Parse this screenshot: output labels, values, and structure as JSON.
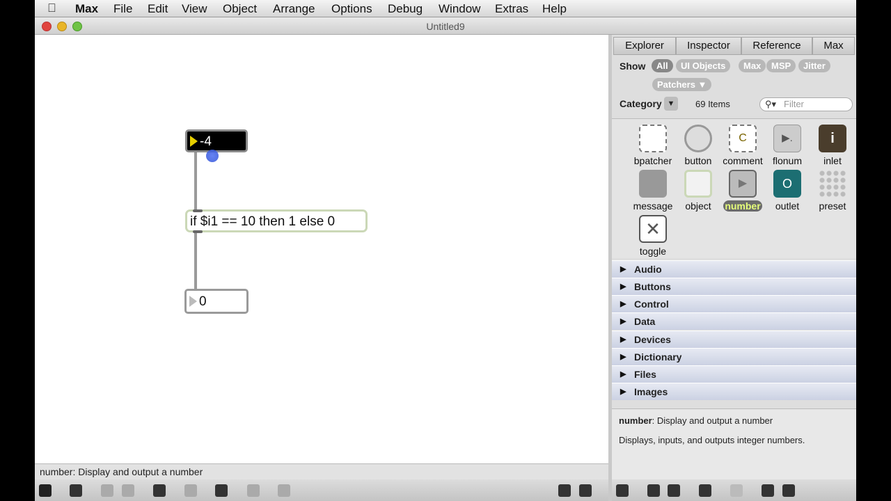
{
  "menubar": {
    "apple_icon": "apple-logo",
    "items": [
      "Max",
      "File",
      "Edit",
      "View",
      "Object",
      "Arrange",
      "Options",
      "Debug",
      "Window",
      "Extras",
      "Help"
    ]
  },
  "window": {
    "title": "Untitled9"
  },
  "patcher": {
    "number_top": "-4",
    "expr_text": "if $i1 == 10 then 1 else 0",
    "number_bottom": "0"
  },
  "status_text": "number: Display and output a number",
  "sidebar": {
    "tabs": [
      "Explorer",
      "Inspector",
      "Reference",
      "Max"
    ],
    "show_label": "Show",
    "filters": [
      "All",
      "UI Objects",
      "Max",
      "MSP",
      "Jitter"
    ],
    "active_filter": "All",
    "patchers_filter": "Patchers ▼",
    "category_label": "Category",
    "category_dropdown": "▼",
    "item_count": "69 Items",
    "filter_placeholder": "Filter",
    "palette": [
      {
        "name": "bpatcher",
        "icon": "bpatcher-icon"
      },
      {
        "name": "button",
        "icon": "button-icon"
      },
      {
        "name": "comment",
        "icon": "comment-icon",
        "glyph": "C"
      },
      {
        "name": "flonum",
        "icon": "flonum-icon",
        "glyph": "▶."
      },
      {
        "name": "inlet",
        "icon": "inlet-icon",
        "glyph": "i"
      },
      {
        "name": "message",
        "icon": "message-icon"
      },
      {
        "name": "object",
        "icon": "object-icon"
      },
      {
        "name": "number",
        "icon": "number-icon",
        "glyph": "▶"
      },
      {
        "name": "outlet",
        "icon": "outlet-icon",
        "glyph": "O"
      },
      {
        "name": "preset",
        "icon": "preset-icon"
      },
      {
        "name": "toggle",
        "icon": "toggle-icon",
        "glyph": "✕"
      }
    ],
    "selected_palette_item": "number",
    "categories": [
      "Audio",
      "Buttons",
      "Control",
      "Data",
      "Devices",
      "Dictionary",
      "Files",
      "Images"
    ],
    "description_title": "number",
    "description_short": ": Display and output a number",
    "description_long": "Displays, inputs, and outputs integer numbers."
  }
}
